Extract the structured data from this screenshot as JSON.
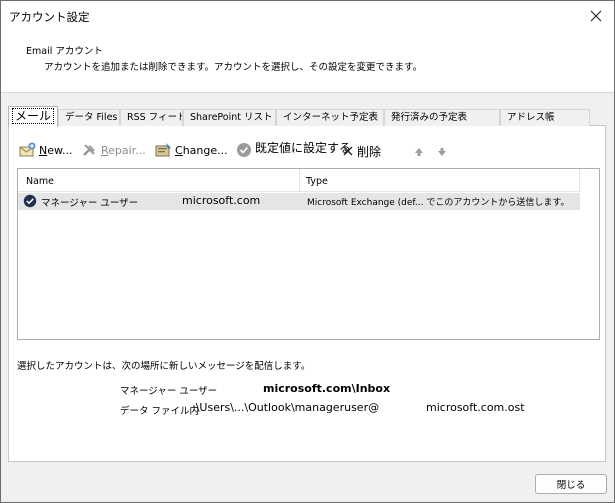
{
  "window": {
    "title": "アカウント設定"
  },
  "header": {
    "title": "Email アカウント",
    "description": "アカウントを追加または削除できます。アカウントを選択し、その設定を変更できます。"
  },
  "tabs": [
    {
      "label": "メール",
      "active": true
    },
    {
      "label": "データ Files",
      "active": false
    },
    {
      "label": "RSS フィード",
      "active": false
    },
    {
      "label": "SharePoint リスト",
      "active": false
    },
    {
      "label": "インターネット予定表",
      "active": false
    },
    {
      "label": "発行済みの予定表",
      "active": false
    },
    {
      "label": "アドレス帳",
      "active": false
    }
  ],
  "toolbar": {
    "new": {
      "label_u": "N",
      "label_rest": "ew...",
      "icon": "new-account-icon"
    },
    "repair": {
      "label_u": "R",
      "label_rest": "epair...",
      "icon": "repair-tools-icon",
      "disabled": true
    },
    "change": {
      "label_u": "C",
      "label_rest": "hange...",
      "icon": "change-account-icon"
    },
    "set_default": {
      "label": "既定値に設定する",
      "icon": "checkmark-circle-icon"
    },
    "delete": {
      "label": "削除",
      "icon": "delete-x-icon"
    },
    "move_up_icon": "arrow-up-icon",
    "move_down_icon": "arrow-down-icon"
  },
  "accounts_list": {
    "columns": [
      "Name",
      "Type"
    ],
    "rows": [
      {
        "name_prefix": "マネージャー ユーザー",
        "name_domain": "microsoft.com",
        "type": "Microsoft Exchange (def... でこのアカウントから送信します。",
        "default": true
      }
    ]
  },
  "delivery": {
    "label": "選択したアカウントは、次の場所に新しいメッセージを配信します。",
    "mailbox_user": "マネージャー ユーザー",
    "mailbox_path": "microsoft.com\\Inbox",
    "datafile_label": "データ ファイル内",
    "datafile_path": ":\\Users\\...\\Outlook\\manageruser@",
    "datafile_domain": "microsoft.com.ost"
  },
  "footer": {
    "close_label": "閉じる"
  }
}
